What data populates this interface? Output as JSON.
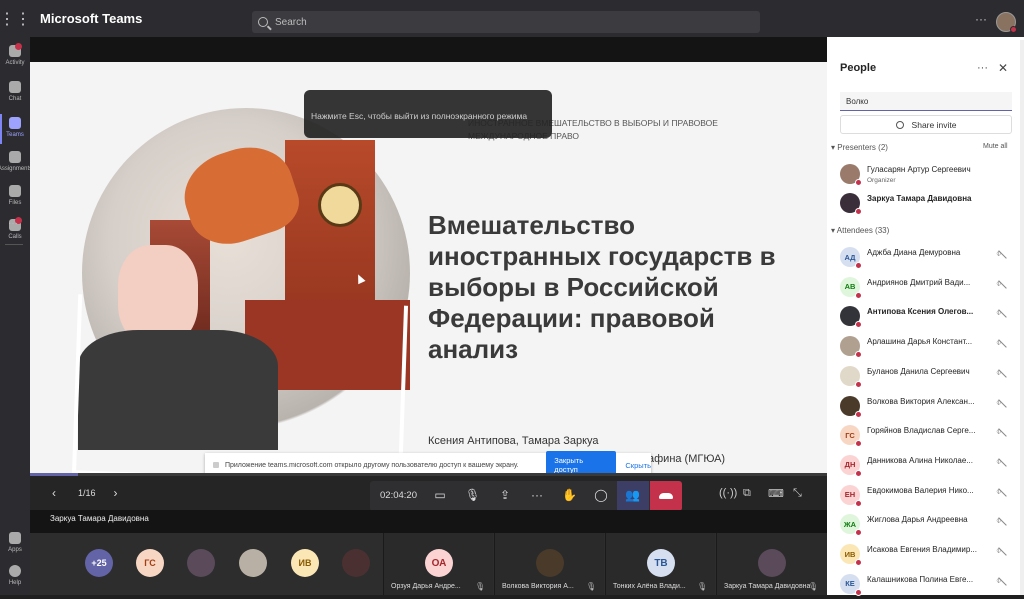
{
  "app": {
    "title": "Microsoft Teams",
    "search_placeholder": "Search",
    "more": "···"
  },
  "rail": [
    {
      "label": "Activity",
      "active": false,
      "badge": true
    },
    {
      "label": "Chat",
      "active": false,
      "badge": false
    },
    {
      "label": "Teams",
      "active": true,
      "badge": false
    },
    {
      "label": "Assignments",
      "active": false,
      "badge": false
    },
    {
      "label": "Files",
      "active": false,
      "badge": false
    },
    {
      "label": "Calls",
      "active": false,
      "badge": true
    }
  ],
  "rail_bottom": {
    "apps": "Apps",
    "help": "Help",
    "more": "···"
  },
  "slide": {
    "header_text": "ИНОСТРАННОЕ ВМЕШАТЕЛЬСТВО В ВЫБОРЫ И ПРАВОВОЕ МЕЖДУНАРОДНОЕ ПРАВО",
    "title": "Вмешательство иностранных государств в выборы в Российской Федерации: правовой анализ",
    "authors": "Ксения Антипова, Тамара Заркуа",
    "org": "афина (МГЮА)"
  },
  "esc_hint": "Нажмите Esc, чтобы выйти из полноэкранного режима",
  "notice": {
    "text": "Приложение teams.microsoft.com открыло другому пользователю доступ к вашему экрану.",
    "stop_button": "Закрыть доступ",
    "hide_link": "Скрыть"
  },
  "share_progress": 0.06,
  "pager": {
    "page": "1/16"
  },
  "meeting": {
    "timer": "02:04:20"
  },
  "presenter_label": "Заркуа Тамара Давидовна",
  "gallery": {
    "overflow": "+25",
    "avatars": [
      {
        "initials": "ГС",
        "color": "#f7d7c4",
        "text_color": "#a33d13"
      },
      {
        "initials": "",
        "color": "#5a4a5a",
        "text_color": "#fff"
      },
      {
        "initials": "",
        "color": "#b8b0a4",
        "text_color": "#fff"
      },
      {
        "initials": "ИВ",
        "color": "#fbe7b5",
        "text_color": "#8a5a00"
      },
      {
        "initials": "",
        "color": "#4a3030",
        "text_color": "#fff"
      }
    ],
    "tiles": [
      {
        "initials": "ОА",
        "name": "Орзуя Дарья Андре...",
        "color": "#fbd3d3",
        "text_color": "#a4262c"
      },
      {
        "initials": "",
        "name": "Волкова Виктория А...",
        "color": "#4a3a2a",
        "text_color": "#fff"
      },
      {
        "initials": "ТВ",
        "name": "Тонких Алёна Влади...",
        "color": "#d5dff0",
        "text_color": "#2b5797"
      },
      {
        "initials": "",
        "name": "Заркуа Тамара Давидовна",
        "color": "#5a4a5a",
        "text_color": "#fff"
      }
    ]
  },
  "people_panel": {
    "title": "People",
    "more": "···",
    "close": "✕",
    "search_value": "Волко",
    "share_invite": "Share invite",
    "presenters_label": "Presenters (2)",
    "mute_all": "Mute all",
    "attendees_label": "Attendees (33)",
    "presenters": [
      {
        "initials": "",
        "name": "Гуласарян Артур Сергеевич",
        "role": "Organizer",
        "color": "#9a7a6a",
        "text_color": "#fff",
        "bold": false
      },
      {
        "initials": "",
        "name": "Заркуа Тамара Давидовна",
        "role": "",
        "color": "#3a2e3a",
        "text_color": "#fff",
        "bold": true
      }
    ],
    "attendees": [
      {
        "initials": "АД",
        "name": "Аджба Диана Демуровна",
        "color": "#d5dff0",
        "text_color": "#2b5797",
        "bold": false
      },
      {
        "initials": "АВ",
        "name": "Андриянов Дмитрий Вади...",
        "color": "#dff6dd",
        "text_color": "#107c10",
        "bold": false
      },
      {
        "initials": "",
        "name": "Антипова Ксения Олегов...",
        "color": "#33333a",
        "text_color": "#fff",
        "bold": true
      },
      {
        "initials": "",
        "name": "Арлашина Дарья Констант...",
        "color": "#b0a090",
        "text_color": "#fff",
        "bold": false
      },
      {
        "initials": "",
        "name": "Буланов Данила Сергеевич",
        "color": "#e0d8c8",
        "text_color": "#555",
        "bold": false
      },
      {
        "initials": "",
        "name": "Волкова Виктория Алексан...",
        "color": "#4a3a2a",
        "text_color": "#fff",
        "bold": false
      },
      {
        "initials": "ГС",
        "name": "Горяйнов Владислав Серге...",
        "color": "#f7d7c4",
        "text_color": "#a33d13",
        "bold": false
      },
      {
        "initials": "ДН",
        "name": "Данникова Алина Николае...",
        "color": "#fbd3d3",
        "text_color": "#a4262c",
        "bold": false
      },
      {
        "initials": "ЕН",
        "name": "Евдокимова Валерия Нико...",
        "color": "#fbd3d3",
        "text_color": "#a4262c",
        "bold": false
      },
      {
        "initials": "ЖА",
        "name": "Жиглова Дарья Андреевна",
        "color": "#dff6dd",
        "text_color": "#107c10",
        "bold": false
      },
      {
        "initials": "ИВ",
        "name": "Исакова Евгения Владимир...",
        "color": "#fbe7b5",
        "text_color": "#8a5a00",
        "bold": false
      },
      {
        "initials": "КЕ",
        "name": "Калашникова Полина Евге...",
        "color": "#d5dff0",
        "text_color": "#2b5797",
        "bold": false
      }
    ]
  }
}
